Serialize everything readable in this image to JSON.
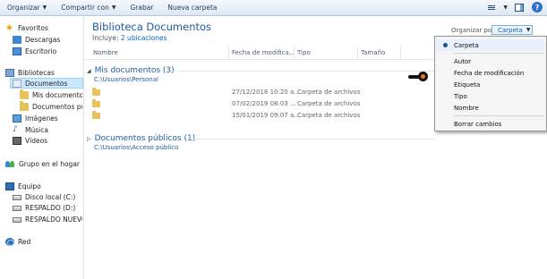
{
  "toolbar": {
    "organize": "Organizar",
    "share": "Compartir con",
    "burn": "Grabar",
    "new_folder": "Nueva carpeta"
  },
  "sidebar": {
    "favorites": "Favoritos",
    "downloads": "Descargas",
    "desktop": "Escritorio",
    "libraries": "Bibliotecas",
    "documents": "Documentos",
    "my_documents": "Mis documentos",
    "public_documents": "Documentos públ",
    "images": "Imágenes",
    "music": "Música",
    "videos": "Vídeos",
    "homegroup": "Grupo en el hogar",
    "computer": "Equipo",
    "local_disk": "Disco local (C:)",
    "backup_d": "RESPALDO (D:)",
    "backup_new": "RESPALDO NUEVO (",
    "network": "Red"
  },
  "main": {
    "title": "Biblioteca Documentos",
    "includes_label": "Incluye:",
    "includes_link": "2 ubicaciones",
    "arrange_label": "Organizar por:",
    "arrange_value": "Carpeta",
    "columns": {
      "name": "Nombre",
      "modified": "Fecha de modifica...",
      "type": "Tipo",
      "size": "Tamaño"
    },
    "groups": [
      {
        "title": "Mis documentos (3)",
        "path": "C:\\Usuarios\\Personal",
        "rows": [
          {
            "name": "",
            "modified": "27/12/2018 10:20 a...",
            "type": "Carpeta de archivos"
          },
          {
            "name": "",
            "modified": "07/02/2019 08:03 ...",
            "type": "Carpeta de archivos"
          },
          {
            "name": "",
            "modified": "15/01/2019 09:07 a...",
            "type": "Carpeta de archivos"
          }
        ]
      },
      {
        "title": "Documentos públicos (1)",
        "path": "C:\\Usuarios\\Acceso público",
        "rows": []
      }
    ]
  },
  "menu": {
    "folder": "Carpeta",
    "author": "Autor",
    "modified_date": "Fecha de modificación",
    "tag": "Etiqueta",
    "type": "Tipo",
    "name": "Nombre",
    "clear": "Borrar cambios"
  },
  "icons": {
    "view": "view-options-icon",
    "preview_pane": "preview-pane-icon",
    "help": "help-icon"
  },
  "colors": {
    "accent": "#1e5b9e",
    "link": "#0066cc",
    "selected_bg": "#cce8ff",
    "folder": "#e8c25a",
    "pointer": "#e8761a"
  }
}
